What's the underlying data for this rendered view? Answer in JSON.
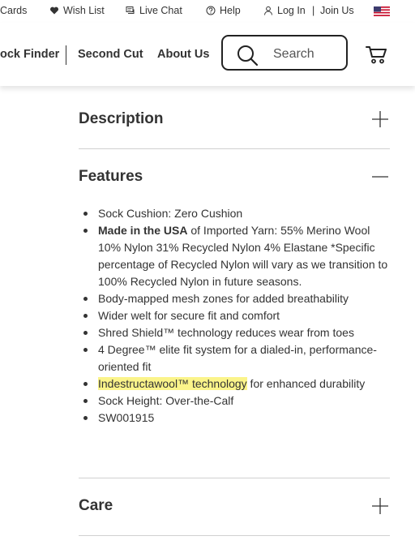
{
  "utility_bar": {
    "gift_cards": "Cards",
    "wish_list": "Wish List",
    "live_chat": "Live Chat",
    "help": "Help",
    "log_in": "Log In",
    "separator": "|",
    "join_us": "Join Us",
    "flag_icon": "us-flag-icon"
  },
  "nav": {
    "sock_finder": "ock Finder",
    "second_cut": "Second Cut",
    "about_us": "About Us",
    "search_placeholder": "Search",
    "cart_icon": "cart-icon"
  },
  "accordions": {
    "description": {
      "title": "Description",
      "state": "collapsed",
      "icon": "plus-icon"
    },
    "features": {
      "title": "Features",
      "state": "expanded",
      "icon": "minus-icon"
    },
    "care": {
      "title": "Care",
      "state": "collapsed",
      "icon": "plus-icon"
    }
  },
  "features": {
    "items": [
      {
        "text": "Sock Cushion: Zero Cushion"
      },
      {
        "bold": "Made in the USA",
        "text": " of Imported Yarn: 55% Merino Wool 10% Nylon 31% Recycled Nylon 4% Elastane *Specific percentage of Recycled Nylon will vary as we transition to 100% Recycled Nylon in future seasons."
      },
      {
        "text": "Body-mapped mesh zones for added breathability"
      },
      {
        "text": "Wider welt for secure fit and comfort"
      },
      {
        "text": "Shred Shield™ technology reduces wear from toes"
      },
      {
        "text": "4 Degree™ elite fit system for a dialed-in, performance-oriented fit"
      },
      {
        "highlight": "Indestructawool™ technology",
        "text": " for enhanced durability"
      },
      {
        "text": "Sock Height: Over-the-Calf"
      },
      {
        "text": "SW001915"
      }
    ]
  },
  "colors": {
    "text": "#333333",
    "highlight": "#fbf48a",
    "divider": "#d0d0d0"
  }
}
